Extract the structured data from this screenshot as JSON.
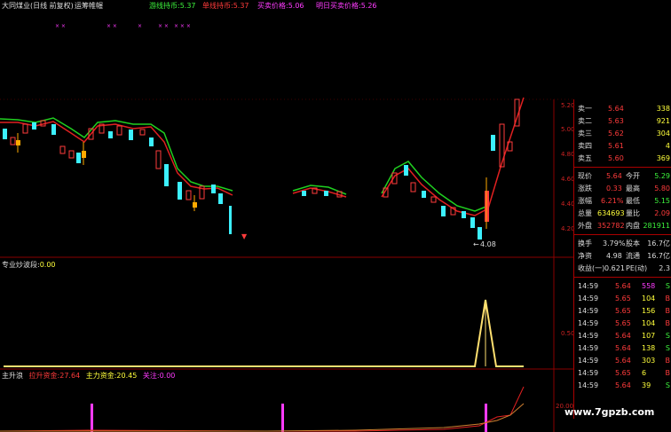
{
  "header": {
    "title": "大同煤业(日线 前复权)",
    "title_suffix": "运筹帷幄",
    "items": [
      {
        "label": "游线持币:",
        "value": "5.37",
        "color": "#3cf23c"
      },
      {
        "label": "单线持币:",
        "value": "5.37",
        "color": "#ff3b3b"
      },
      {
        "label": "买卖价格:",
        "value": "5.06",
        "color": "#ff3bff"
      },
      {
        "label": "明日买卖价格:",
        "value": "5.26",
        "color": "#ff3bff"
      }
    ]
  },
  "kline": {
    "low_label": "4.08",
    "axis_ticks": [
      "5.20",
      "5.00",
      "4.80",
      "4.60",
      "4.40",
      "4.20"
    ]
  },
  "indicator1": {
    "label": "专业炒波段:",
    "value": "0.00",
    "axis_tick": "0.50"
  },
  "indicator2": {
    "name": "主升浪",
    "items": [
      {
        "label": "拉升资金:",
        "value": "27.64",
        "color": "#ff3b3b"
      },
      {
        "label": "主力资金:",
        "value": "20.45",
        "color": "#ffff3b"
      },
      {
        "label": "关注:",
        "value": "0.00",
        "color": "#ff3bff"
      }
    ],
    "axis_tick": "20.00"
  },
  "quote": {
    "bids": [
      {
        "label": "卖一",
        "price": "5.64",
        "vol": "338"
      },
      {
        "label": "卖二",
        "price": "5.63",
        "vol": "921"
      },
      {
        "label": "卖三",
        "price": "5.62",
        "vol": "304"
      },
      {
        "label": "卖四",
        "price": "5.61",
        "vol": "4"
      },
      {
        "label": "卖五",
        "price": "5.60",
        "vol": "369"
      }
    ],
    "stats": [
      {
        "l1": "现价",
        "v1": "5.64",
        "c1": "#ff3b3b",
        "l2": "今开",
        "v2": "5.29",
        "c2": "#3cf23c"
      },
      {
        "l1": "涨跌",
        "v1": "0.33",
        "c1": "#ff3b3b",
        "l2": "最高",
        "v2": "5.80",
        "c2": "#ff3b3b"
      },
      {
        "l1": "涨幅",
        "v1": "6.21%",
        "c1": "#ff3b3b",
        "l2": "最低",
        "v2": "5.15",
        "c2": "#3cf23c"
      },
      {
        "l1": "总量",
        "v1": "634693",
        "c1": "#ffff3b",
        "l2": "量比",
        "v2": "2.09",
        "c2": "#ff3b3b"
      },
      {
        "l1": "外盘",
        "v1": "352782",
        "c1": "#ff3b3b",
        "l2": "内盘",
        "v2": "281911",
        "c2": "#3cf23c"
      }
    ],
    "stats2": [
      {
        "l1": "换手",
        "v1": "3.79%",
        "l2": "股本",
        "v2": "16.7亿"
      },
      {
        "l1": "净资",
        "v1": "4.98",
        "l2": "流通",
        "v2": "16.7亿"
      },
      {
        "l1": "收益(一)",
        "v1": "0.621",
        "l2": "PE(动)",
        "v2": "2.3"
      }
    ],
    "trades": [
      {
        "time": "14:59",
        "price": "5.64",
        "vol": "558",
        "side": "S"
      },
      {
        "time": "14:59",
        "price": "5.65",
        "vol": "104",
        "side": "B"
      },
      {
        "time": "14:59",
        "price": "5.65",
        "vol": "156",
        "side": "B"
      },
      {
        "time": "14:59",
        "price": "5.65",
        "vol": "104",
        "side": "B"
      },
      {
        "time": "14:59",
        "price": "5.64",
        "vol": "107",
        "side": "S"
      },
      {
        "time": "14:59",
        "price": "5.64",
        "vol": "138",
        "side": "S"
      },
      {
        "time": "14:59",
        "price": "5.64",
        "vol": "303",
        "side": "B"
      },
      {
        "time": "14:59",
        "price": "5.65",
        "vol": "6",
        "side": "B"
      },
      {
        "time": "14:59",
        "price": "5.64",
        "vol": "39",
        "side": "S"
      }
    ]
  },
  "watermark": "www.7gpzb.com",
  "colors": {
    "up": "#ff3b3b",
    "down": "#3cf0ff",
    "ma_red": "#e02020",
    "ma_green": "#20d020",
    "grid": "#8a0000"
  }
}
